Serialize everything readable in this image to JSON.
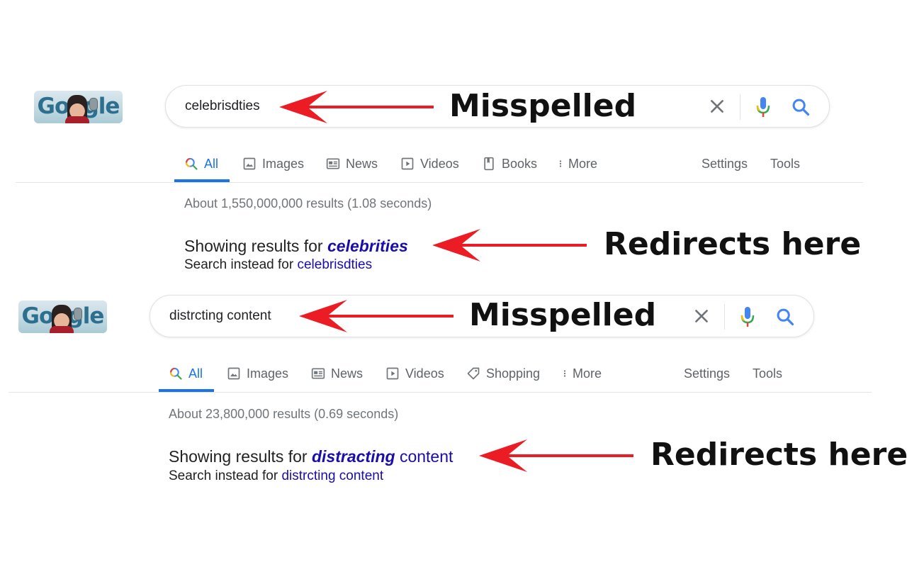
{
  "colors": {
    "annotation_arrow": "#ec1c24",
    "link": "#1a0dab",
    "accent": "#1a73e8"
  },
  "screens": [
    {
      "logo_text": "Google",
      "query": "celebrisdties",
      "tabs": [
        {
          "label": "All",
          "icon": "search-icon",
          "active": true
        },
        {
          "label": "Images",
          "icon": "image-icon"
        },
        {
          "label": "News",
          "icon": "news-icon"
        },
        {
          "label": "Videos",
          "icon": "video-icon"
        },
        {
          "label": "Books",
          "icon": "book-icon"
        },
        {
          "label": "More",
          "icon": "more-vert-icon"
        }
      ],
      "settings_label": "Settings",
      "tools_label": "Tools",
      "stats": "About 1,550,000,000 results (1.08 seconds)",
      "showing_prefix": "Showing results for",
      "correction_bold": "celebrities",
      "correction_rest": "",
      "instead_prefix": "Search instead for",
      "instead_link": "celebrisdties",
      "annotation_query": "Misspelled",
      "annotation_result": "Redirects here"
    },
    {
      "logo_text": "Google",
      "query": "distrcting content",
      "tabs": [
        {
          "label": "All",
          "icon": "search-icon",
          "active": true
        },
        {
          "label": "Images",
          "icon": "image-icon"
        },
        {
          "label": "News",
          "icon": "news-icon"
        },
        {
          "label": "Videos",
          "icon": "video-icon"
        },
        {
          "label": "Shopping",
          "icon": "tag-icon"
        },
        {
          "label": "More",
          "icon": "more-vert-icon"
        }
      ],
      "settings_label": "Settings",
      "tools_label": "Tools",
      "stats": "About 23,800,000 results (0.69 seconds)",
      "showing_prefix": "Showing results for",
      "correction_bold": "distracting",
      "correction_rest": "content",
      "instead_prefix": "Search instead for",
      "instead_link": "distrcting content",
      "annotation_query": "Misspelled",
      "annotation_result": "Redirects here"
    }
  ]
}
